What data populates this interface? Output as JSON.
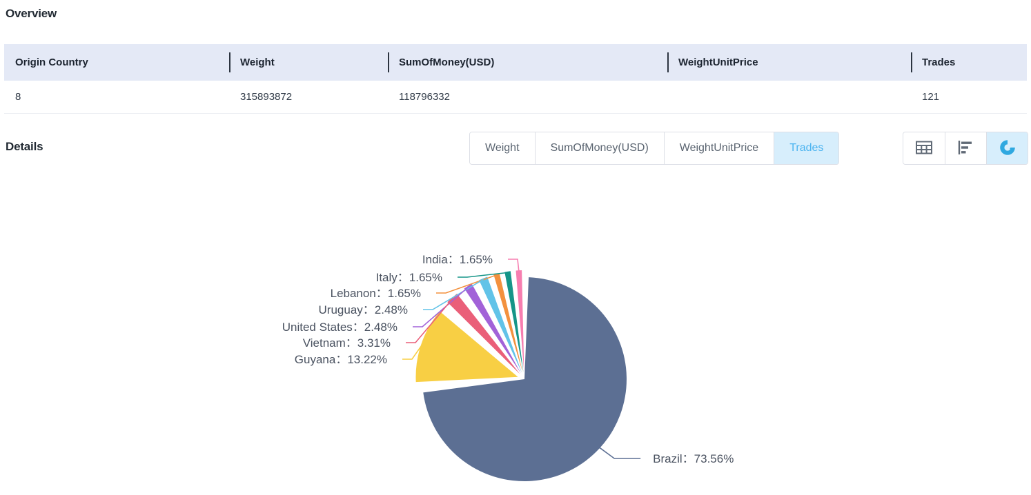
{
  "overview": {
    "title": "Overview",
    "columns": [
      "Origin Country",
      "Weight",
      "SumOfMoney(USD)",
      "WeightUnitPrice",
      "Trades"
    ],
    "rows": [
      {
        "origin_country": "8",
        "weight": "315893872",
        "sum_of_money_usd": "118796332",
        "weight_unit_price": "",
        "trades": "121"
      }
    ]
  },
  "details": {
    "title": "Details",
    "metric_tabs": [
      {
        "label": "Weight",
        "active": false
      },
      {
        "label": "SumOfMoney(USD)",
        "active": false
      },
      {
        "label": "WeightUnitPrice",
        "active": false
      },
      {
        "label": "Trades",
        "active": true
      }
    ],
    "view_modes": [
      {
        "icon": "table-view-icon",
        "active": false
      },
      {
        "icon": "bar-chart-view-icon",
        "active": false
      },
      {
        "icon": "pie-chart-view-icon",
        "active": true
      }
    ]
  },
  "colors": {
    "accent": "#4ab3f0",
    "accent_bg": "#d7eefc",
    "header_bg": "#e4e9f6",
    "text": "#303a47"
  },
  "chart_data": {
    "type": "pie",
    "title": "",
    "metric": "Trades",
    "value_suffix": "%",
    "label_separator": "：",
    "total_trades": 121,
    "legend": "labels-outside",
    "categories": [
      "Brazil",
      "Guyana",
      "Vietnam",
      "United States",
      "Uruguay",
      "Lebanon",
      "Italy",
      "India"
    ],
    "values": [
      73.56,
      13.22,
      3.31,
      2.48,
      2.48,
      1.65,
      1.65,
      1.65
    ],
    "slice_colors": [
      "#5c6f93",
      "#f8cf44",
      "#ea5f79",
      "#a262d8",
      "#62c3e8",
      "#f3913e",
      "#159588",
      "#f77eb0"
    ],
    "labels": [
      {
        "name": "Brazil",
        "value": 73.56,
        "text": "Brazil：73.56%",
        "color": "#5c6f93"
      },
      {
        "name": "Guyana",
        "value": 13.22,
        "text": "Guyana：13.22%",
        "color": "#f8cf44"
      },
      {
        "name": "Vietnam",
        "value": 3.31,
        "text": "Vietnam：3.31%",
        "color": "#ea5f79"
      },
      {
        "name": "United States",
        "value": 2.48,
        "text": "United States：2.48%",
        "color": "#a262d8"
      },
      {
        "name": "Uruguay",
        "value": 2.48,
        "text": "Uruguay：2.48%",
        "color": "#62c3e8"
      },
      {
        "name": "Lebanon",
        "value": 1.65,
        "text": "Lebanon：1.65%",
        "color": "#f3913e"
      },
      {
        "name": "Italy",
        "value": 1.65,
        "text": "Italy：1.65%",
        "color": "#159588"
      },
      {
        "name": "India",
        "value": 1.65,
        "text": "India：1.65%",
        "color": "#f77eb0"
      }
    ]
  }
}
